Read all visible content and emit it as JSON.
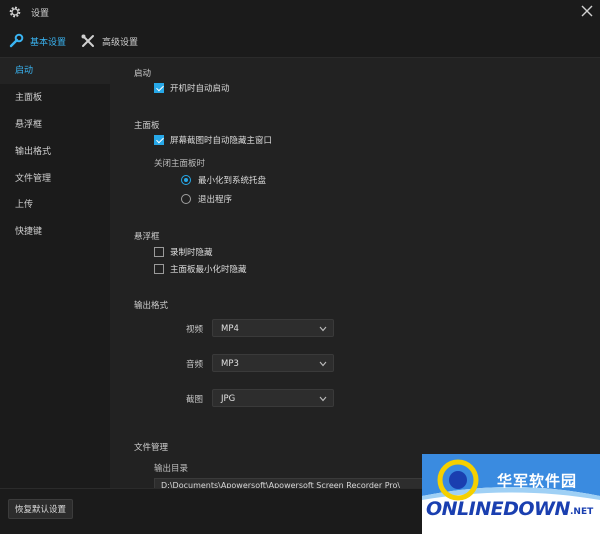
{
  "window": {
    "title": "设置"
  },
  "tabs": [
    {
      "label": "基本设置",
      "active": true
    },
    {
      "label": "高级设置",
      "active": false
    }
  ],
  "sidebar": {
    "items": [
      {
        "label": "启动"
      },
      {
        "label": "主面板"
      },
      {
        "label": "悬浮框"
      },
      {
        "label": "输出格式"
      },
      {
        "label": "文件管理"
      },
      {
        "label": "上传"
      },
      {
        "label": "快捷键"
      }
    ]
  },
  "startup": {
    "title": "启动",
    "auto_start": {
      "label": "开机时自动启动",
      "checked": true
    }
  },
  "main_panel": {
    "title": "主面板",
    "hide_on_capture": {
      "label": "屏幕截图时自动隐藏主窗口",
      "checked": true
    },
    "close_title": "关闭主面板时",
    "options": [
      {
        "label": "最小化到系统托盘",
        "selected": true
      },
      {
        "label": "退出程序",
        "selected": false
      }
    ]
  },
  "float_box": {
    "title": "悬浮框",
    "hide_recording": {
      "label": "录制时隐藏",
      "checked": false
    },
    "hide_minimized": {
      "label": "主面板最小化时隐藏",
      "checked": false
    }
  },
  "output": {
    "title": "输出格式",
    "video": {
      "label": "视频",
      "value": "MP4"
    },
    "audio": {
      "label": "音频",
      "value": "MP3"
    },
    "screenshot": {
      "label": "截图",
      "value": "JPG"
    }
  },
  "file_mgmt": {
    "title": "文件管理",
    "dir_label": "输出目录",
    "dir_value": "D:\\Documents\\Apowersoft\\Apowersoft Screen Recorder Pro\\"
  },
  "footer": {
    "reset_label": "恢复默认设置"
  },
  "watermark": {
    "brand": "华军软件园",
    "word": "ONLINEDOWN",
    "suffix": ".NET"
  },
  "colors": {
    "accent": "#27a8e8",
    "background": "#1f1f1f",
    "sidebar": "#1b1b1b",
    "content": "#222222"
  }
}
